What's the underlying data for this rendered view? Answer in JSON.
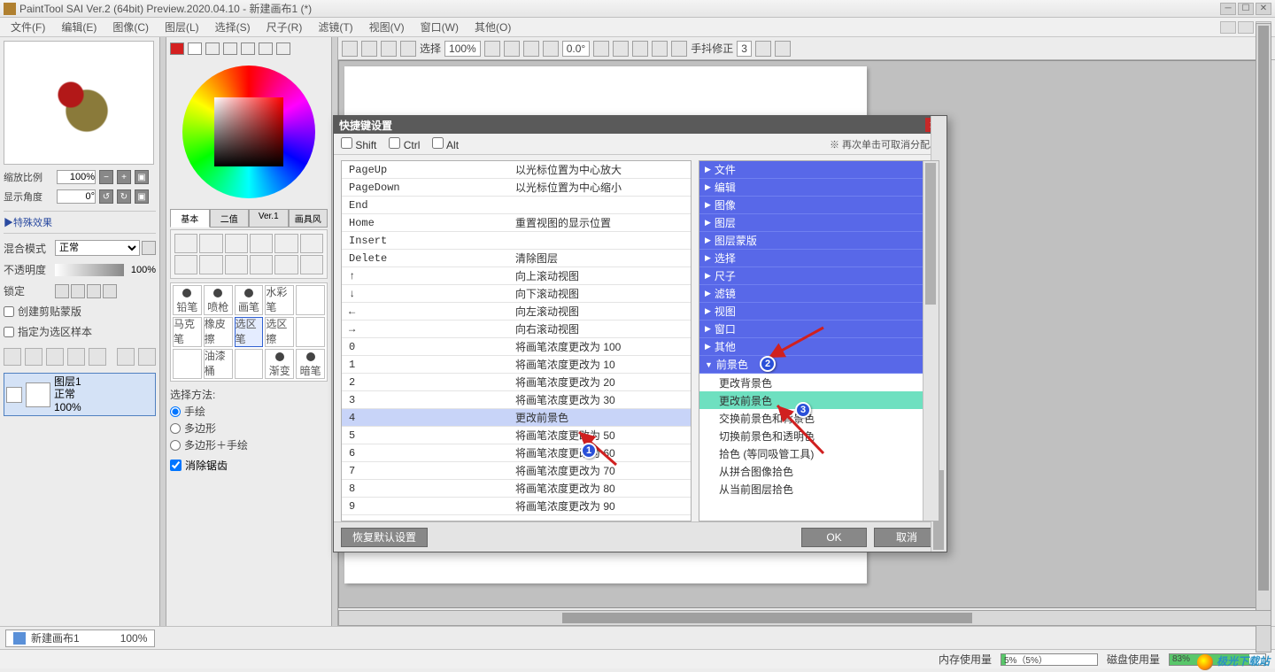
{
  "app": {
    "title": "PaintTool SAI Ver.2 (64bit) Preview.2020.04.10 - 新建画布1 (*)"
  },
  "menu": {
    "items": [
      "文件(F)",
      "编辑(E)",
      "图像(C)",
      "图层(L)",
      "选择(S)",
      "尺子(R)",
      "滤镜(T)",
      "视图(V)",
      "窗口(W)",
      "其他(O)"
    ]
  },
  "left": {
    "zoom_label": "缩放比例",
    "zoom_value": "100%",
    "angle_label": "显示角度",
    "angle_value": "0°",
    "fx_label": "▶特殊效果",
    "blend_label": "混合模式",
    "blend_value": "正常",
    "opacity_label": "不透明度",
    "opacity_value": "100%",
    "lock_label": "锁定",
    "clip_label": "创建剪贴蒙版",
    "sample_label": "指定为选区样本",
    "layer": {
      "name": "图层1",
      "mode": "正常",
      "opacity": "100%"
    }
  },
  "mid": {
    "tabs": [
      "基本",
      "二值",
      "Ver.1",
      "画具风"
    ],
    "brushes_row1": [
      "铅笔",
      "喷枪",
      "画笔",
      "水彩笔",
      ""
    ],
    "brushes_row2": [
      "马克笔",
      "橡皮擦",
      "选区笔",
      "选区擦",
      ""
    ],
    "brushes_row3": [
      "",
      "油漆桶",
      "",
      "渐变",
      "暗笔"
    ],
    "sel_label": "选择方法:",
    "sel_opts": [
      "手绘",
      "多边形",
      "多边形＋手绘"
    ],
    "antialias": "消除锯齿"
  },
  "canvas_toolbar": {
    "sel_label": "选择",
    "zoom": "100%",
    "angle": "0.0°",
    "stabilizer_label": "手抖修正",
    "stabilizer_value": "3"
  },
  "doc": {
    "name": "新建画布1",
    "zoom": "100%"
  },
  "status": {
    "mem_label": "内存使用量",
    "mem_text": "5%（5%）",
    "mem_pct": 5,
    "disk_label": "磁盘使用量",
    "disk_text": "83%",
    "disk_pct": 83
  },
  "watermark": "极光下载站",
  "dialog": {
    "title": "快捷键设置",
    "mods": [
      "Shift",
      "Ctrl",
      "Alt"
    ],
    "hint": "※ 再次单击可取消分配。",
    "keys": [
      {
        "k": "PageUp",
        "v": "以光标位置为中心放大"
      },
      {
        "k": "PageDown",
        "v": "以光标位置为中心缩小"
      },
      {
        "k": "End",
        "v": ""
      },
      {
        "k": "Home",
        "v": "重置视图的显示位置"
      },
      {
        "k": "Insert",
        "v": ""
      },
      {
        "k": "Delete",
        "v": "清除图层"
      },
      {
        "k": "↑",
        "v": "向上滚动视图"
      },
      {
        "k": "↓",
        "v": "向下滚动视图"
      },
      {
        "k": "←",
        "v": "向左滚动视图"
      },
      {
        "k": "→",
        "v": "向右滚动视图"
      },
      {
        "k": "0",
        "v": "将画笔浓度更改为 100"
      },
      {
        "k": "1",
        "v": "将画笔浓度更改为 10"
      },
      {
        "k": "2",
        "v": "将画笔浓度更改为 20"
      },
      {
        "k": "3",
        "v": "将画笔浓度更改为 30"
      },
      {
        "k": "4",
        "v": "更改前景色"
      },
      {
        "k": "5",
        "v": "将画笔浓度更改为 50"
      },
      {
        "k": "6",
        "v": "将画笔浓度更改为 60"
      },
      {
        "k": "7",
        "v": "将画笔浓度更改为 70"
      },
      {
        "k": "8",
        "v": "将画笔浓度更改为 80"
      },
      {
        "k": "9",
        "v": "将画笔浓度更改为 90"
      }
    ],
    "selected_key_index": 14,
    "categories": [
      "文件",
      "编辑",
      "图像",
      "图层",
      "图层蒙版",
      "选择",
      "尺子",
      "滤镜",
      "视图",
      "窗口",
      "其他"
    ],
    "open_category": "前景色",
    "sub_items": [
      "更改背景色",
      "更改前景色",
      "交换前景色和背景色",
      "切换前景色和透明色",
      "拾色 (等同吸管工具)",
      "从拼合图像拾色",
      "从当前图层拾色"
    ],
    "highlight_sub_index": 1,
    "restore": "恢复默认设置",
    "ok": "OK",
    "cancel": "取消"
  },
  "badges": [
    "1",
    "2",
    "3"
  ]
}
